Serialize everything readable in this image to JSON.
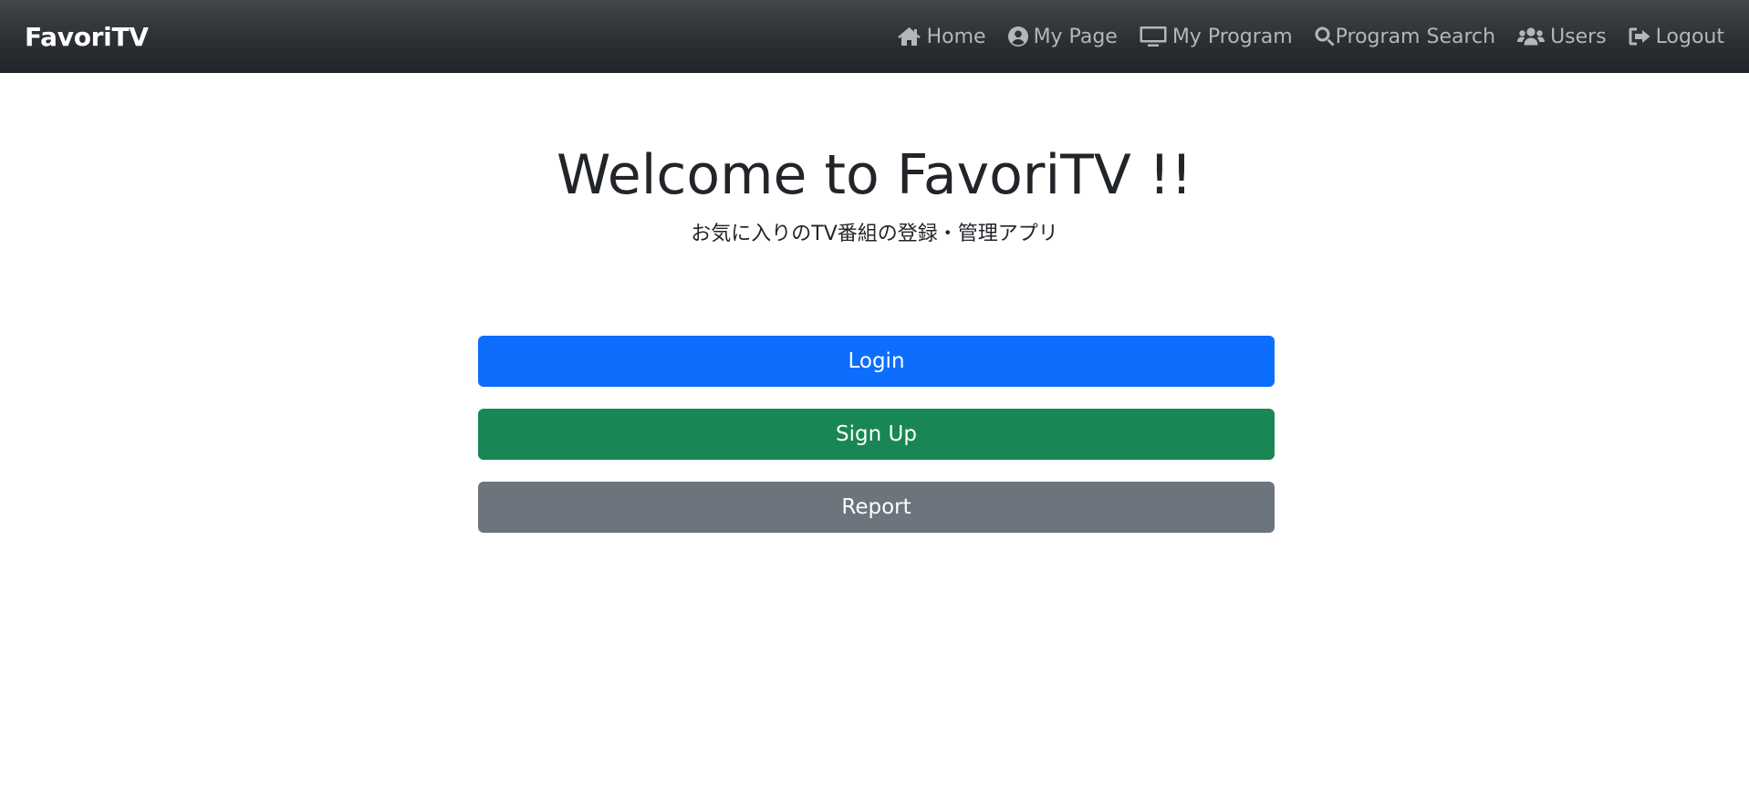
{
  "colors": {
    "navbar_bg": "#212529",
    "nav_link": "#b3b6ba",
    "primary": "#0d6efd",
    "success": "#198754",
    "secondary": "#6c757d"
  },
  "navbar": {
    "brand": "FavoriTV",
    "links": [
      {
        "label": "Home",
        "icon": "home-icon"
      },
      {
        "label": "My Page",
        "icon": "user-circle-icon"
      },
      {
        "label": "My Program",
        "icon": "tv-icon"
      },
      {
        "label": "Program Search",
        "icon": "search-icon"
      },
      {
        "label": "Users",
        "icon": "users-icon"
      },
      {
        "label": "Logout",
        "icon": "logout-icon"
      }
    ]
  },
  "hero": {
    "title": "Welcome to FavoriTV !!",
    "subtitle": "お気に入りのTV番組の登録・管理アプリ"
  },
  "buttons": {
    "login": "Login",
    "signup": "Sign Up",
    "report": "Report"
  }
}
